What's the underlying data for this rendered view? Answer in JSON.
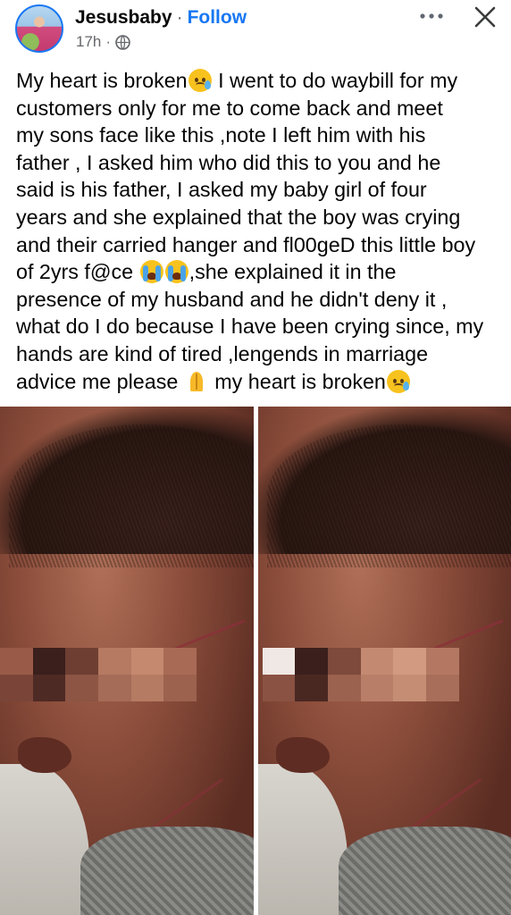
{
  "post": {
    "author": "Jesusbaby",
    "separator": "·",
    "follow_label": "Follow",
    "time": "17h",
    "meta_separator": "·",
    "audience_icon": "globe-icon",
    "lines": [
      "My heart is broken",
      " I went to do waybill for my",
      "customers only for me to come back and meet",
      "my sons face like this ,note I left him with his",
      "father , I asked him who did this to you and he",
      "said is his father, I asked my baby girl of four",
      "years and she explained that the boy was crying",
      "and their carried hanger and fl00geD this little boy",
      "of 2yrs f@ce ",
      ",she explained it in the",
      "presence of my husband  and he didn't deny it ,",
      "what do I do because I have been crying since, my",
      "hands are kind of tired ,lengends in marriage",
      "advice me please ",
      " my heart is broken"
    ]
  },
  "icons": {
    "more": "more-options-icon",
    "close": "close-icon"
  },
  "colors": {
    "brand": "#1877f2",
    "text": "#050505",
    "muted": "#65676b"
  }
}
